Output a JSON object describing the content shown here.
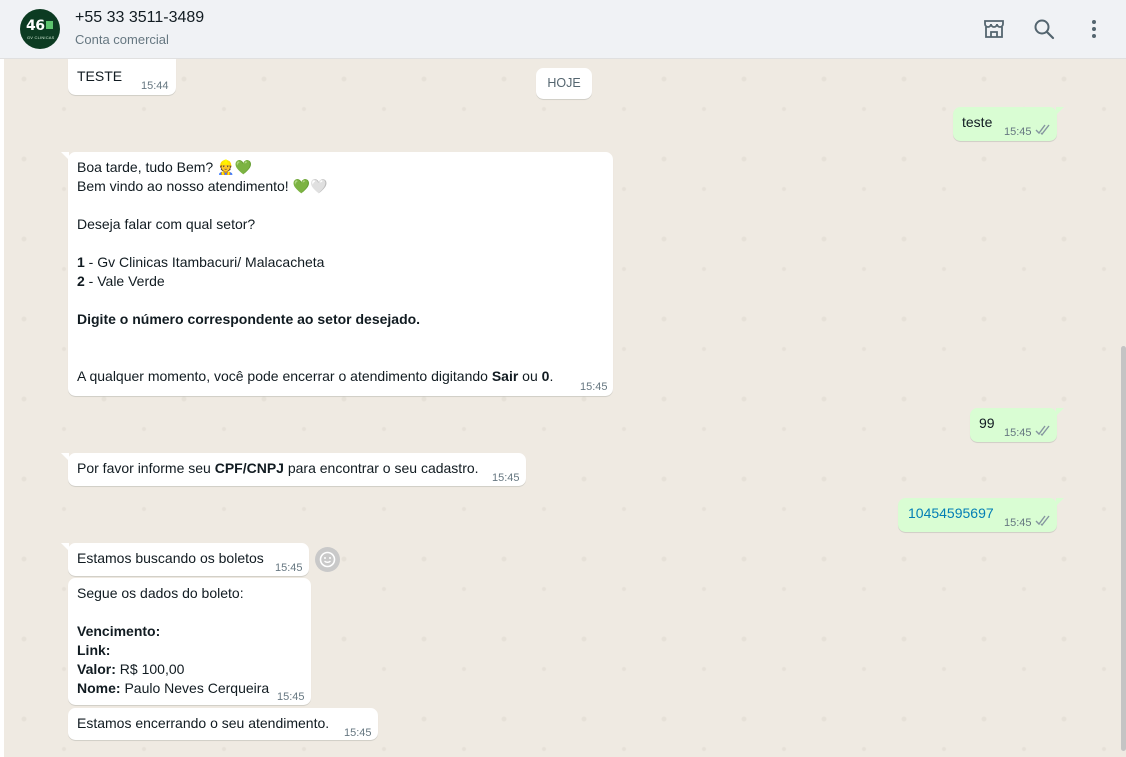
{
  "header": {
    "avatar_text": "46",
    "avatar_sub": "GV CLINICAS",
    "title": "+55 33 3511-3489",
    "subtitle": "Conta comercial",
    "icons": [
      "store-icon",
      "search-icon",
      "menu-dots-icon"
    ]
  },
  "date_divider": "HOJE",
  "messages": [
    {
      "dir": "in",
      "text": "TESTE",
      "time": "15:44"
    },
    {
      "dir": "out",
      "text": "teste",
      "time": "15:45"
    },
    {
      "dir": "in",
      "time": "15:45",
      "line1": "Boa tarde, tudo Bem? 👷💚",
      "line2": "Bem vindo ao nosso atendimento! 💚🤍",
      "line3": "Deseja falar com qual setor?",
      "opt1_num": "1",
      "opt1_text": " - Gv Clinicas Itambacuri/ Malacacheta",
      "opt2_num": "2",
      "opt2_text": " - Vale Verde",
      "instruction": "Digite o número correspondente ao setor desejado.",
      "closing_pre": "A qualquer momento, você pode encerrar o atendimento digitando ",
      "closing_b1": "Sair",
      "closing_mid": " ou ",
      "closing_b2": "0",
      "closing_post": "."
    },
    {
      "dir": "out",
      "text": "99",
      "time": "15:45"
    },
    {
      "dir": "in",
      "time": "15:45",
      "pre": "Por favor informe seu ",
      "bold": "CPF/CNPJ",
      "post": " para encontrar o seu cadastro."
    },
    {
      "dir": "out",
      "text": "10454595697",
      "time": "15:45"
    },
    {
      "dir": "in",
      "text": "Estamos buscando os boletos",
      "time": "15:45"
    },
    {
      "dir": "in",
      "time": "15:45",
      "intro": "Segue os dados do boleto:",
      "venc_label": "Vencimento:",
      "link_label": "Link:",
      "valor_label": "Valor:",
      "valor_value": " R$ 100,00",
      "nome_label": "Nome:",
      "nome_value": " Paulo Neves Cerqueira"
    },
    {
      "dir": "in",
      "text": "Estamos encerrando o seu atendimento.",
      "time": "15:45"
    }
  ],
  "colors": {
    "incoming": "#ffffff",
    "outgoing": "#d9fdd3",
    "chat_bg": "#efeae2",
    "tick": "#8696a0",
    "link": "#027eb5"
  }
}
